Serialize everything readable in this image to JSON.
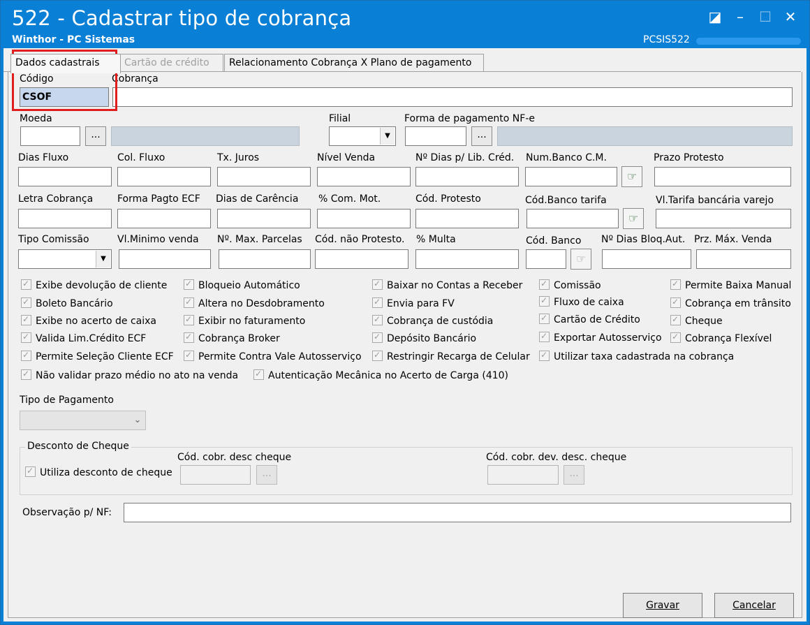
{
  "window": {
    "title": "522 - Cadastrar tipo de cobrança",
    "subtitle": "Winthor - PC Sistemas",
    "routine_code": "PCSIS522",
    "controls": {
      "restore": "◪",
      "minimize": "–",
      "maximize": "☐",
      "close": "✕"
    }
  },
  "tabs": [
    {
      "label": "Dados cadastrais",
      "state": "active"
    },
    {
      "label": "Cartão de crédito",
      "state": "disabled"
    },
    {
      "label": "Relacionamento Cobrança X Plano de pagamento",
      "state": "enabled"
    }
  ],
  "fields": {
    "codigo": {
      "label": "Código",
      "value": "CSOF"
    },
    "cobranca": {
      "label": "Cobrança",
      "value": ""
    },
    "moeda": {
      "label": "Moeda",
      "value": ""
    },
    "filial": {
      "label": "Filial",
      "value": ""
    },
    "forma_pagamento_nfe": {
      "label": "Forma de pagamento NF-e",
      "value": ""
    },
    "dias_fluxo": {
      "label": "Dias Fluxo"
    },
    "col_fluxo": {
      "label": "Col. Fluxo"
    },
    "tx_juros": {
      "label": "Tx. Juros"
    },
    "nivel_venda": {
      "label": "Nível Venda"
    },
    "dias_lib_cred": {
      "label": "Nº Dias p/ Lib. Créd."
    },
    "num_banco_cm": {
      "label": "Num.Banco C.M."
    },
    "prazo_protesto": {
      "label": "Prazo Protesto"
    },
    "letra_cobranca": {
      "label": "Letra Cobrança"
    },
    "forma_pagto_ecf": {
      "label": "Forma Pagto ECF"
    },
    "dias_carencia": {
      "label": "Dias de Carência"
    },
    "com_mot": {
      "label": "% Com. Mot."
    },
    "cod_protesto": {
      "label": "Cód. Protesto"
    },
    "cod_banco_tarifa": {
      "label": "Cód.Banco tarifa"
    },
    "vl_tarifa_bancaria": {
      "label": "Vl.Tarifa bancária varejo"
    },
    "tipo_comissao": {
      "label": "Tipo Comissão"
    },
    "vl_minimo_venda": {
      "label": "Vl.Minimo venda"
    },
    "max_parcelas": {
      "label": "Nº. Max. Parcelas"
    },
    "cod_nao_protesto": {
      "label": "Cód. não Protesto."
    },
    "multa": {
      "label": "% Multa"
    },
    "cod_banco": {
      "label": "Cód. Banco"
    },
    "dias_bloq_aut": {
      "label": "Nº Dias Bloq.Aut."
    },
    "prz_max_venda": {
      "label": "Prz. Máx. Venda"
    },
    "tipo_pagamento": {
      "label": "Tipo de Pagamento",
      "value": ""
    },
    "observacao_nf": {
      "label": "Observação p/ NF:",
      "value": ""
    }
  },
  "checkboxes": [
    {
      "label": "Exibe devolução de cliente",
      "checked": true
    },
    {
      "label": "Bloqueio Automático",
      "checked": true
    },
    {
      "label": "Baixar no Contas a Receber",
      "checked": true
    },
    {
      "label": "Comissão",
      "checked": true
    },
    {
      "label": "Permite Baixa Manual",
      "checked": true
    },
    {
      "label": "Boleto Bancário",
      "checked": true
    },
    {
      "label": "Altera no Desdobramento",
      "checked": true
    },
    {
      "label": "Envia para FV",
      "checked": true
    },
    {
      "label": "Fluxo de caixa",
      "checked": true
    },
    {
      "label": "Cobrança em trânsito",
      "checked": true
    },
    {
      "label": "Exibe no acerto de caixa",
      "checked": true
    },
    {
      "label": "Exibir no faturamento",
      "checked": true
    },
    {
      "label": "Cobrança de custódia",
      "checked": true
    },
    {
      "label": "Cartão de Crédito",
      "checked": true
    },
    {
      "label": "Cheque",
      "checked": true
    },
    {
      "label": "Valida Lim.Crédito ECF",
      "checked": true
    },
    {
      "label": "Cobrança Broker",
      "checked": true
    },
    {
      "label": "Depósito Bancário",
      "checked": true
    },
    {
      "label": "Exportar Autosserviço",
      "checked": true
    },
    {
      "label": "Cobrança Flexível",
      "checked": true
    },
    {
      "label": "Permite Seleção Cliente ECF",
      "checked": true
    },
    {
      "label": "Permite Contra Vale Autosserviço",
      "checked": true
    },
    {
      "label": "Restringir Recarga de Celular",
      "checked": true
    },
    {
      "label": "Utilizar taxa cadastrada na cobrança",
      "checked": true
    },
    {
      "label": "Não validar prazo médio no ato na venda",
      "checked": true
    },
    {
      "label": "Autenticação Mecânica no Acerto de Carga (410)",
      "checked": true
    }
  ],
  "desconto_cheque": {
    "title": "Desconto de Cheque",
    "utiliza_label": "Utiliza desconto de cheque",
    "cod_cobr_desc_label": "Cód. cobr. desc cheque",
    "cod_cobr_dev_label": "Cód. cobr. dev. desc. cheque"
  },
  "buttons": {
    "dots": "...",
    "hand": "☞",
    "dropdown_arrow": "▼",
    "combo_chevron": "⌄",
    "gravar": "Gravar",
    "cancelar": "Cancelar"
  },
  "colors": {
    "titlebar": "#0a7fd6",
    "highlight": "#e01e1e",
    "selected_input": "#c7d7ee"
  }
}
